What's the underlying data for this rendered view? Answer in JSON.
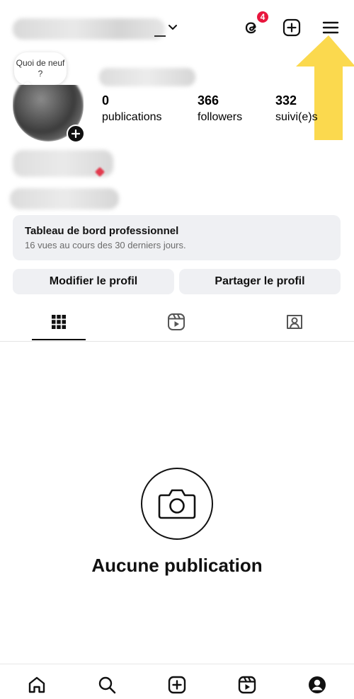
{
  "header": {
    "badge_count": "4",
    "icons": [
      "chevron-down-icon",
      "threads-icon",
      "new-post-icon",
      "menu-icon"
    ]
  },
  "profile": {
    "note_text": "Quoi de neuf ?",
    "stats": [
      {
        "value": "0",
        "label": "publications"
      },
      {
        "value": "366",
        "label": "followers"
      },
      {
        "value": "332",
        "label": "suivi(e)s"
      }
    ]
  },
  "dashboard": {
    "title": "Tableau de bord professionnel",
    "subtitle": "16 vues au cours des 30 derniers jours."
  },
  "actions": {
    "edit_label": "Modifier le profil",
    "share_label": "Partager le profil"
  },
  "tabs": [
    "grid-icon",
    "reels-icon",
    "tagged-icon"
  ],
  "empty_state": {
    "title": "Aucune publication",
    "icon": "camera-icon"
  },
  "bottom_nav": [
    "home-icon",
    "search-icon",
    "create-icon",
    "reels-icon",
    "profile-icon"
  ],
  "colors": {
    "badge": "#e8163d",
    "arrow": "#fbd94e",
    "panel": "#eff0f3"
  }
}
